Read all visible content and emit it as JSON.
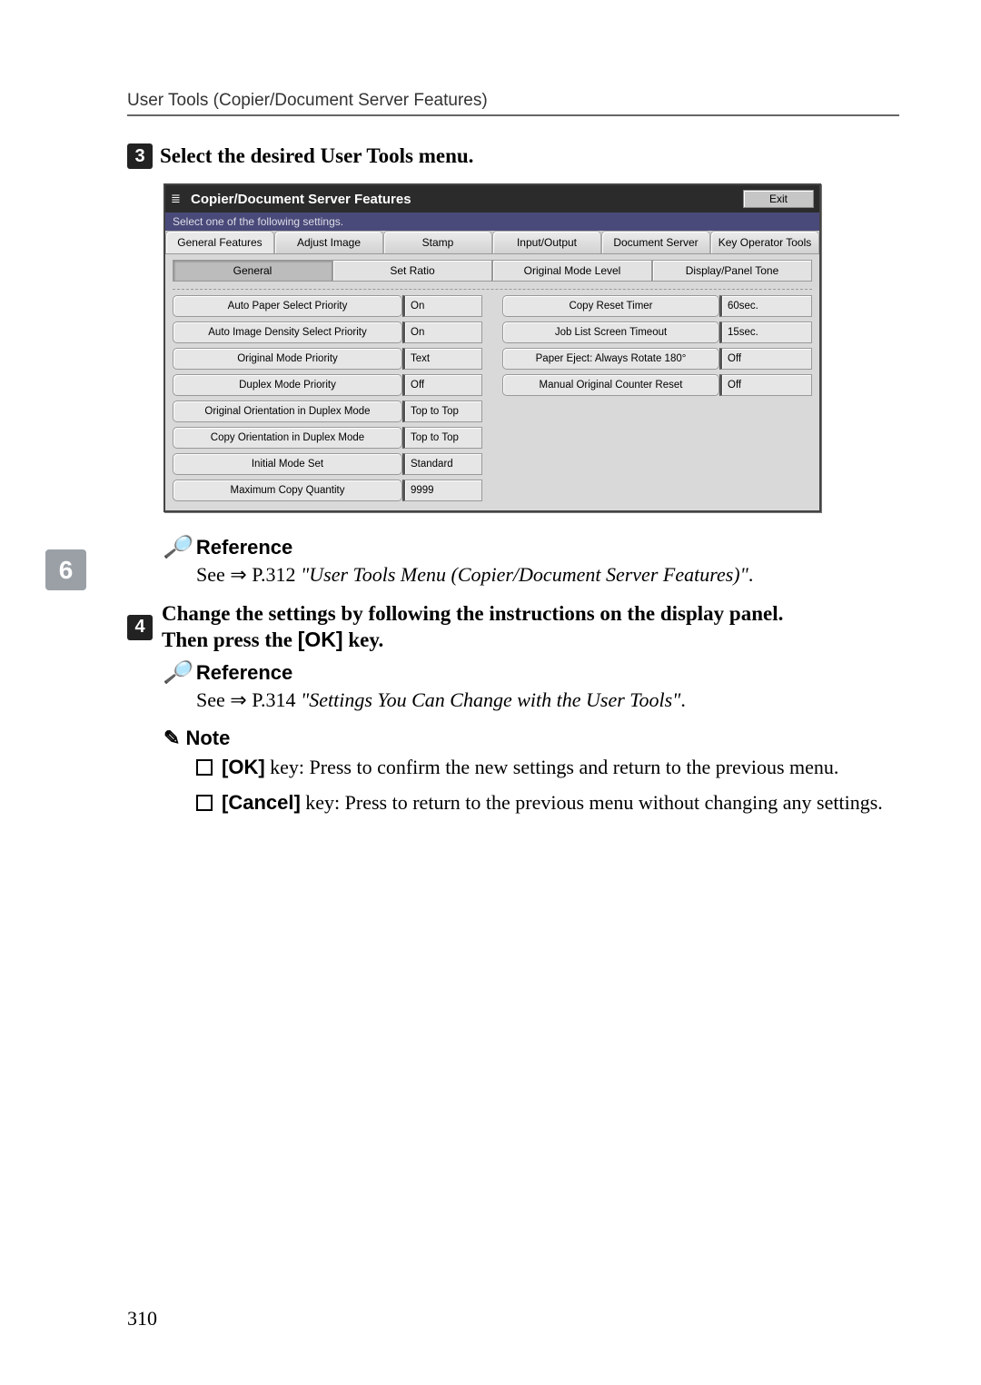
{
  "header": "User Tools (Copier/Document Server Features)",
  "side_chapter": "6",
  "step3": {
    "num": "3",
    "text": "Select the desired User Tools menu."
  },
  "panel": {
    "title": "Copier/Document Server Features",
    "exit": "Exit",
    "subtitle": "Select one of the following settings.",
    "tabs": [
      "General Features",
      "Adjust Image",
      "Stamp",
      "Input/Output",
      "Document Server",
      "Key Operator Tools"
    ],
    "subtabs": [
      "General",
      "Set Ratio",
      "Original Mode Level",
      "Display/Panel Tone"
    ],
    "left_rows": [
      {
        "label": "Auto Paper Select Priority",
        "value": "On"
      },
      {
        "label": "Auto Image Density Select Priority",
        "value": "On"
      },
      {
        "label": "Original Mode Priority",
        "value": "Text"
      },
      {
        "label": "Duplex Mode Priority",
        "value": "Off"
      },
      {
        "label": "Original Orientation in Duplex Mode",
        "value": "Top to Top"
      },
      {
        "label": "Copy Orientation in Duplex Mode",
        "value": "Top to Top"
      },
      {
        "label": "Initial Mode Set",
        "value": "Standard"
      },
      {
        "label": "Maximum Copy Quantity",
        "value": "9999"
      }
    ],
    "right_rows": [
      {
        "label": "Copy Reset Timer",
        "value": "60sec."
      },
      {
        "label": "Job List Screen Timeout",
        "value": "15sec."
      },
      {
        "label": "Paper Eject: Always Rotate 180°",
        "value": "Off"
      },
      {
        "label": "Manual Original Counter Reset",
        "value": "Off"
      }
    ]
  },
  "ref_label": "Reference",
  "ref1_a": "See ⇒ P.312 ",
  "ref1_b": "\"User Tools Menu (Copier/Document Server Features)\"",
  "step4": {
    "num": "4",
    "line1a": "Change the settings by following the instructions on the display panel.",
    "line2a": "Then press the ",
    "ok": "[OK]",
    "line2b": " key."
  },
  "ref2_a": "See ⇒ P.314 ",
  "ref2_b": "\"Settings You Can Change with the User Tools\"",
  "note_label": "Note",
  "note1": {
    "ok": "[OK]",
    "rest": " key: Press to confirm the new settings and return to the previous menu."
  },
  "note2": {
    "cancel": "[Cancel]",
    "rest": " key: Press to return to the previous menu without changing any settings."
  },
  "pagenum": "310",
  "period": "."
}
